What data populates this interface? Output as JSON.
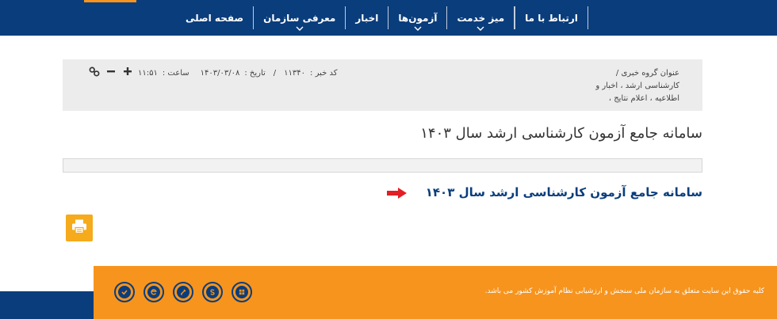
{
  "nav": {
    "items": [
      {
        "label": "صفحه اصلی",
        "has_submenu": false
      },
      {
        "label": "معرفی سازمان",
        "has_submenu": true
      },
      {
        "label": "اخبار",
        "has_submenu": false
      },
      {
        "label": "آزمون‌ها",
        "has_submenu": true
      },
      {
        "label": "میز خدمت",
        "has_submenu": true
      },
      {
        "label": "ارتباط با ما",
        "has_submenu": false
      }
    ]
  },
  "meta": {
    "group_line1": "عنوان گروه خبری /",
    "group_line2": "کارشناسی ارشد ، اخبار و",
    "group_line3": "اطلاعیه ، اعلام نتایج ،",
    "code_label": "کد خبر :",
    "code_value": "۱۱۳۴۰",
    "separator": "/",
    "date_label": "تاریخ :",
    "date_value": "۱۴۰۳/۰۳/۰۸",
    "time_label": "ساعت :",
    "time_value": "۱۱:۵۱"
  },
  "article": {
    "title": "سامانه جامع آزمون کارشناسی ارشد سال ۱۴۰۳",
    "link_text": "سامانه جامع آزمون کارشناسی ارشد سال ۱۴۰۳"
  },
  "footer": {
    "copyright": "کلیه حقوق این سایت متعلق به سازمان ملی سنجش و ارزشیابی نظام آموزش کشور می باشد."
  },
  "colors": {
    "primary": "#0a3d7c",
    "accent": "#f7941d",
    "print": "#f5ab1c",
    "arrow": "#e31e24"
  },
  "icons": {
    "tools": [
      "link-icon",
      "minus-icon",
      "plus-icon"
    ],
    "print": "print-icon",
    "social": [
      "grid-icon",
      "s-icon",
      "pen-icon",
      "e-icon",
      "check-icon"
    ]
  }
}
